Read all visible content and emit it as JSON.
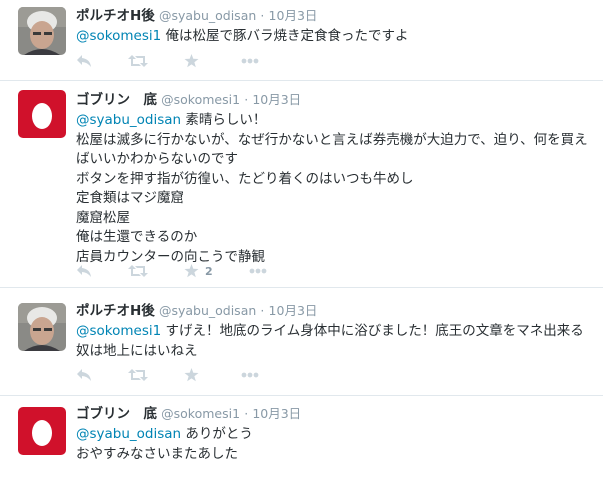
{
  "colors": {
    "link": "#0084b4",
    "muted": "#8899a6",
    "icon": "#ccd6dd",
    "egg_bg": "#d0112b"
  },
  "tweets": [
    {
      "fullname": "ポルチオH後",
      "username": "@syabu_odisan",
      "sep": "·",
      "time": "10月3日",
      "avatar": "photo-avatar",
      "mention": "@sokomesi1",
      "body": " 俺は松屋で豚バラ焼き定食食ったですよ",
      "likes": ""
    },
    {
      "fullname": "ゴブリン　底",
      "username": "@sokomesi1",
      "sep": "·",
      "time": "10月3日",
      "avatar": "egg-avatar",
      "mention": "@syabu_odisan",
      "body": " 素晴らしい！\n松屋は滅多に行かないが、なぜ行かないと言えば券売機が大迫力で、迫り、何を買えばいいかわからないのです\nボタンを押す指が彷徨い、たどり着くのはいつも牛めし\n定食類はマジ魔窟\n魔窟松屋\n俺は生還できるのか\n店員カウンターの向こうで静観",
      "likes": "2"
    },
    {
      "fullname": "ポルチオH後",
      "username": "@syabu_odisan",
      "sep": "·",
      "time": "10月3日",
      "avatar": "photo-avatar",
      "mention": "@sokomesi1",
      "body": " すげえ！地底のライム身体中に浴びました！底王の文章をマネ出来る奴は地上にはいねえ",
      "likes": ""
    },
    {
      "fullname": "ゴブリン　底",
      "username": "@sokomesi1",
      "sep": "·",
      "time": "10月3日",
      "avatar": "egg-avatar",
      "mention": "@syabu_odisan",
      "body": " ありがとう\nおやすみなさいまたあした",
      "likes": ""
    }
  ],
  "icons": {
    "reply": "reply-icon",
    "retweet": "retweet-icon",
    "favorite": "star-icon",
    "more": "more-dots-icon"
  }
}
